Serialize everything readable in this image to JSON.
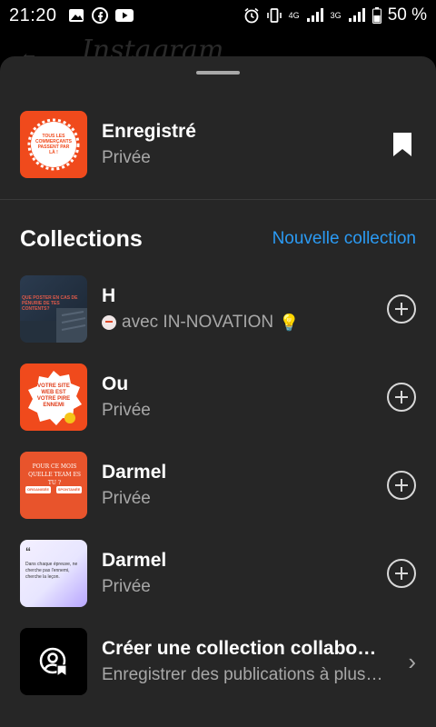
{
  "status_bar": {
    "time": "21:20",
    "network_label_top": "4G",
    "network_label_3g": "3G",
    "battery": "50 %"
  },
  "backdrop": {
    "app_title": "Instagram"
  },
  "saved": {
    "title": "Enregistré",
    "subtitle": "Privée",
    "thumb_text": "TOUS LES COMMERÇANTS PASSENT PAR LÀ !"
  },
  "collections": {
    "heading": "Collections",
    "new_label": "Nouvelle collection",
    "items": [
      {
        "title": "H",
        "subtitle": "avec IN-NOVATION",
        "thumb_text": "QUE POSTER EN CAS DE PÉNURIE DE TES CONTENTS?"
      },
      {
        "title": "Ou",
        "subtitle": "Privée",
        "thumb_text": "VOTRE SITE WEB EST VOTRE PIRE ENNEMI"
      },
      {
        "title": "Darmel",
        "subtitle": "Privée",
        "thumb_text": "POUR CE MOIS QUELLE TEAM ES TU ?",
        "thumb_tag1": "ORGANISÉE",
        "thumb_tag2": "SPONTANÉE"
      },
      {
        "title": "Darmel",
        "subtitle": "Privée",
        "thumb_text": "Dans chaque épreuve, ne cherche pas l'ennemi, cherche la leçon."
      }
    ]
  },
  "create_collab": {
    "title": "Créer une collection collaborative",
    "subtitle": "Enregistrer des publications à plusieurs"
  },
  "colors": {
    "accent": "#2b9bf4",
    "sheet": "#262626",
    "orange": "#f04a1c"
  }
}
